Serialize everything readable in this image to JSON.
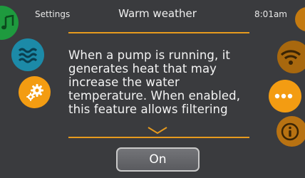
{
  "header": {
    "left_label": "Settings",
    "title": "Warm weather",
    "time": "8:01am"
  },
  "message": {
    "text": "When a pump is running, it generates heat that may increase the water temperature. When enabled, this feature allows filtering"
  },
  "toggle": {
    "label": "On"
  },
  "icons": {
    "left": [
      "music-icon",
      "water-icon",
      "gear-icon"
    ],
    "right": [
      "top-right-icon",
      "wifi-icon",
      "more-icon",
      "info-icon"
    ]
  },
  "colors": {
    "accent": "#e69a1e",
    "background": "#3a3b3e"
  }
}
